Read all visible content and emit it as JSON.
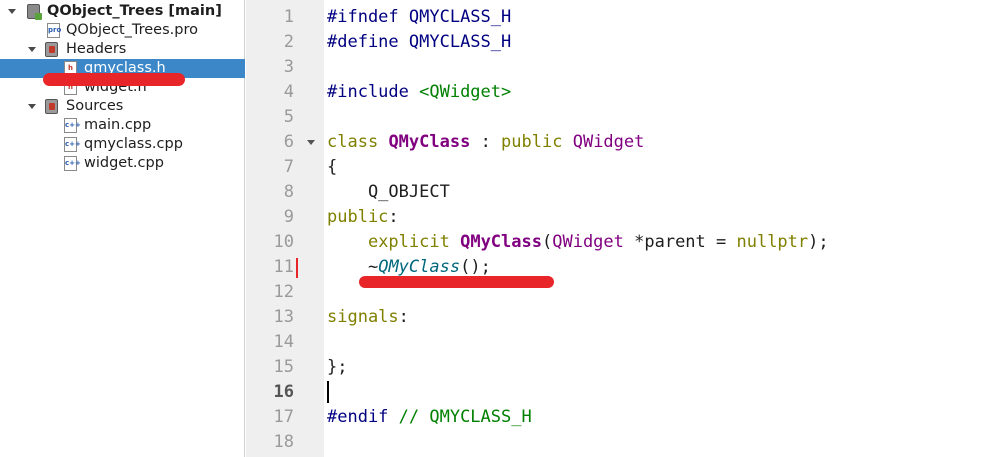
{
  "tree": {
    "project_label": "QObject_Trees [main]",
    "pro_file": "QObject_Trees.pro",
    "headers_label": "Headers",
    "headers": [
      "qmyclass.h",
      "widget.h"
    ],
    "sources_label": "Sources",
    "sources": [
      "main.cpp",
      "qmyclass.cpp",
      "widget.cpp"
    ],
    "selected": "qmyclass.h"
  },
  "editor": {
    "line_numbers": [
      "1",
      "2",
      "3",
      "4",
      "5",
      "6",
      "7",
      "8",
      "9",
      "10",
      "11",
      "12",
      "13",
      "14",
      "15",
      "16",
      "17",
      "18"
    ],
    "current_line": "16",
    "code": {
      "l1_a": "#ifndef",
      "l1_b": " QMYCLASS_H",
      "l2_a": "#define",
      "l2_b": " QMYCLASS_H",
      "l4_a": "#include",
      "l4_b": " <QWidget>",
      "l6_kw": "class",
      "l6_name": "QMyClass",
      "l6_colon": " : ",
      "l6_pub": "public",
      "l6_base": "QWidget",
      "l7": "{",
      "l8": "    Q_OBJECT",
      "l9_kw": "public",
      "l9_p": ":",
      "l10_kw": "explicit",
      "l10_name": "QMyClass",
      "l10_p1": "(",
      "l10_type": "QWidget",
      "l10_p2": " *parent = ",
      "l10_null": "nullptr",
      "l10_p3": ");",
      "l11_t": "~",
      "l11_name": "QMyClass",
      "l11_p": "();",
      "l13_kw": "signals",
      "l13_p": ":",
      "l15": "};",
      "l17_a": "#endif",
      "l17_b": " // QMYCLASS_H"
    }
  },
  "icons": {
    "project": "qt-project-icon",
    "folder": "header-folder-icon",
    "file": "cpp-file-icon"
  }
}
